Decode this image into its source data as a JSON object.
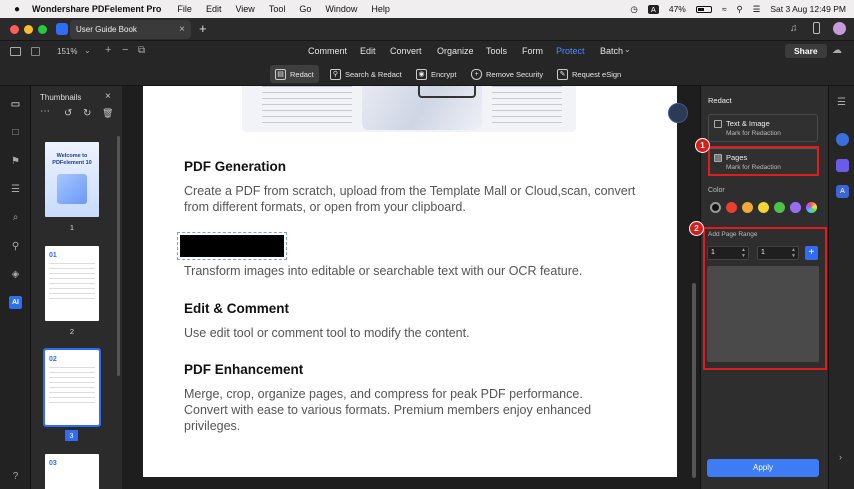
{
  "menubar": {
    "app_name": "Wondershare PDFelement Pro",
    "items": [
      "File",
      "Edit",
      "View",
      "Tool",
      "Go",
      "Window",
      "Help"
    ],
    "input_mode": "A",
    "battery": "47%",
    "datetime": "Sat 3 Aug  12:49 PM"
  },
  "tab": {
    "title": "User Guide Book",
    "close": "×",
    "new": "+"
  },
  "toolbar": {
    "zoom": "151%",
    "nav_tabs": [
      "Comment",
      "Edit",
      "Convert",
      "Organize",
      "Tools",
      "Form",
      "Protect",
      "Batch"
    ],
    "active_tab": "Protect",
    "share": "Share",
    "sub_tools": [
      "Redact",
      "Search & Redact",
      "Encrypt",
      "Remove Security",
      "Request eSign"
    ]
  },
  "thumbnails": {
    "title": "Thumbnails",
    "pages": [
      {
        "num": "1",
        "caption": "Welcome to PDFelement 10"
      },
      {
        "num": "2",
        "caption": "01"
      },
      {
        "num": "3",
        "caption": "02"
      },
      {
        "num": "",
        "caption": "03"
      }
    ],
    "selected": "3"
  },
  "document": {
    "sections": [
      {
        "heading": "PDF Generation",
        "body": "Create a PDF from scratch, upload from the Template Mall or Cloud,scan, convert from different formats, or open from your clipboard."
      },
      {
        "heading": "",
        "body": "Transform images into editable or searchable text with our OCR feature."
      },
      {
        "heading": "Edit & Comment",
        "body": "Use edit tool or comment tool to modify the content."
      },
      {
        "heading": "PDF Enhancement",
        "body": "Merge, crop, organize pages, and compress for peak PDF performance. Convert with ease to various formats. Premium members enjoy enhanced privileges."
      }
    ]
  },
  "redact_panel": {
    "title": "Redact",
    "option1": {
      "title": "Text & Image",
      "sub": "Mark for Redaction"
    },
    "option2": {
      "title": "Pages",
      "sub": "Mark for Redaction"
    },
    "color_label": "Color",
    "colors": [
      "#111111",
      "#e8402e",
      "#f0a93a",
      "#f2d535",
      "#4dc34a",
      "#3b86f0",
      "#9a6cf0"
    ],
    "page_range_label": "Add Page Range",
    "range_from": "1",
    "range_to": "1",
    "add": "+",
    "apply": "Apply",
    "annotations": [
      "1",
      "2"
    ]
  }
}
